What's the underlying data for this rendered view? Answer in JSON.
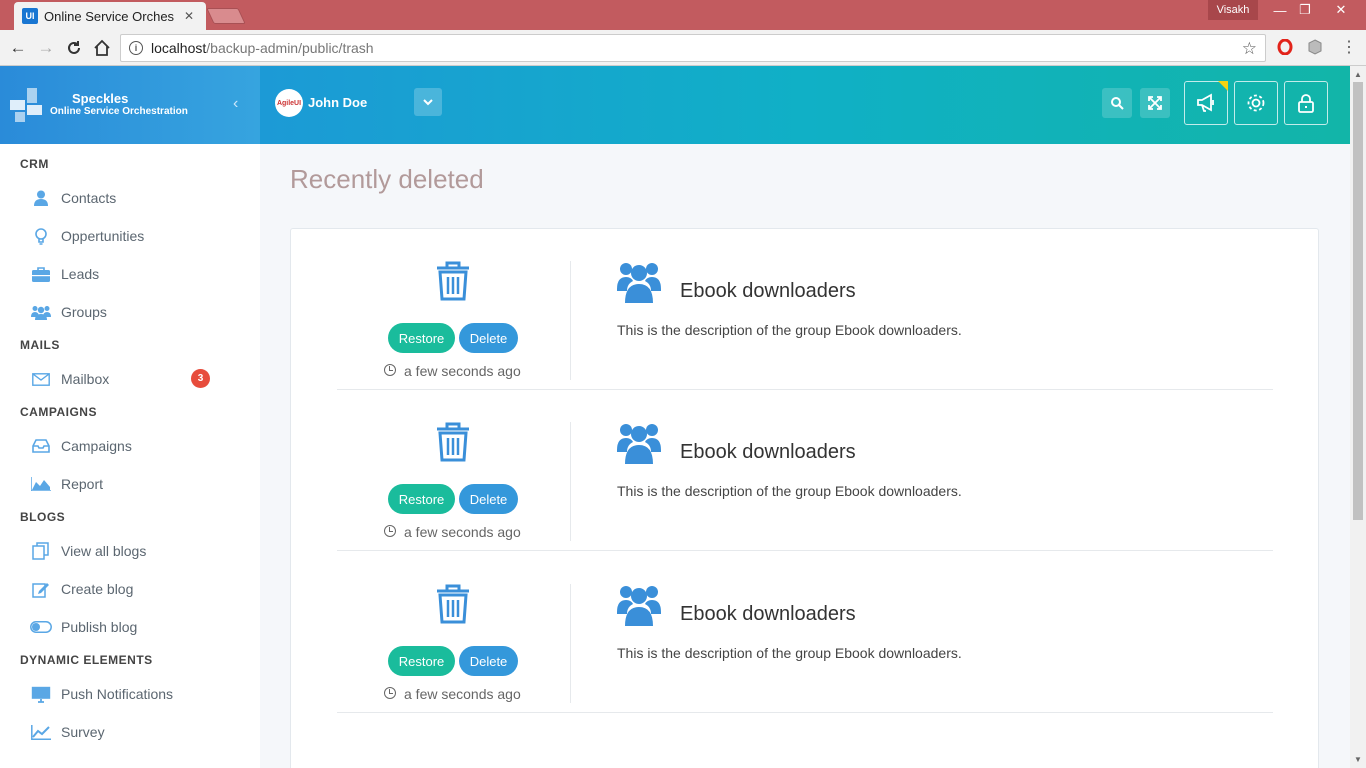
{
  "browser": {
    "tab_title": "Online Service Orchestra",
    "tab_favicon": "UI",
    "profile": "Visakh",
    "url_host": "localhost",
    "url_path": "/backup-admin/public/trash"
  },
  "brand": {
    "name": "Speckles",
    "subtitle": "Online Service Orchestration"
  },
  "header": {
    "user_name": "John Doe",
    "avatar_text": "AgileUI"
  },
  "colors": {
    "primary": "#3498db",
    "accent": "#1abc9c",
    "badge": "#e74c3c",
    "header_start": "#1c9ad6",
    "header_end": "#12b5a8"
  },
  "sidebar": {
    "sections": [
      {
        "title": "CRM",
        "items": [
          {
            "label": "Contacts",
            "icon": "user-icon"
          },
          {
            "label": "Oppertunities",
            "icon": "lightbulb-icon"
          },
          {
            "label": "Leads",
            "icon": "briefcase-icon"
          },
          {
            "label": "Groups",
            "icon": "users-icon"
          }
        ]
      },
      {
        "title": "MAILS",
        "items": [
          {
            "label": "Mailbox",
            "icon": "envelope-icon",
            "badge": "3"
          }
        ]
      },
      {
        "title": "CAMPAIGNS",
        "items": [
          {
            "label": "Campaigns",
            "icon": "inbox-icon"
          },
          {
            "label": "Report",
            "icon": "area-chart-icon"
          }
        ]
      },
      {
        "title": "BLOGS",
        "items": [
          {
            "label": "View all blogs",
            "icon": "copy-icon"
          },
          {
            "label": "Create blog",
            "icon": "edit-icon"
          },
          {
            "label": "Publish blog",
            "icon": "toggle-icon"
          }
        ]
      },
      {
        "title": "DYNAMIC ELEMENTS",
        "items": [
          {
            "label": "Push Notifications",
            "icon": "monitor-icon"
          },
          {
            "label": "Survey",
            "icon": "line-chart-icon"
          }
        ]
      }
    ]
  },
  "main": {
    "title": "Recently deleted",
    "restore_label": "Restore",
    "delete_label": "Delete",
    "items": [
      {
        "name": "Ebook downloaders",
        "description": "This is the description of the group Ebook downloaders.",
        "time": "a few seconds ago"
      },
      {
        "name": "Ebook downloaders",
        "description": "This is the description of the group Ebook downloaders.",
        "time": "a few seconds ago"
      },
      {
        "name": "Ebook downloaders",
        "description": "This is the description of the group Ebook downloaders.",
        "time": "a few seconds ago"
      }
    ]
  }
}
